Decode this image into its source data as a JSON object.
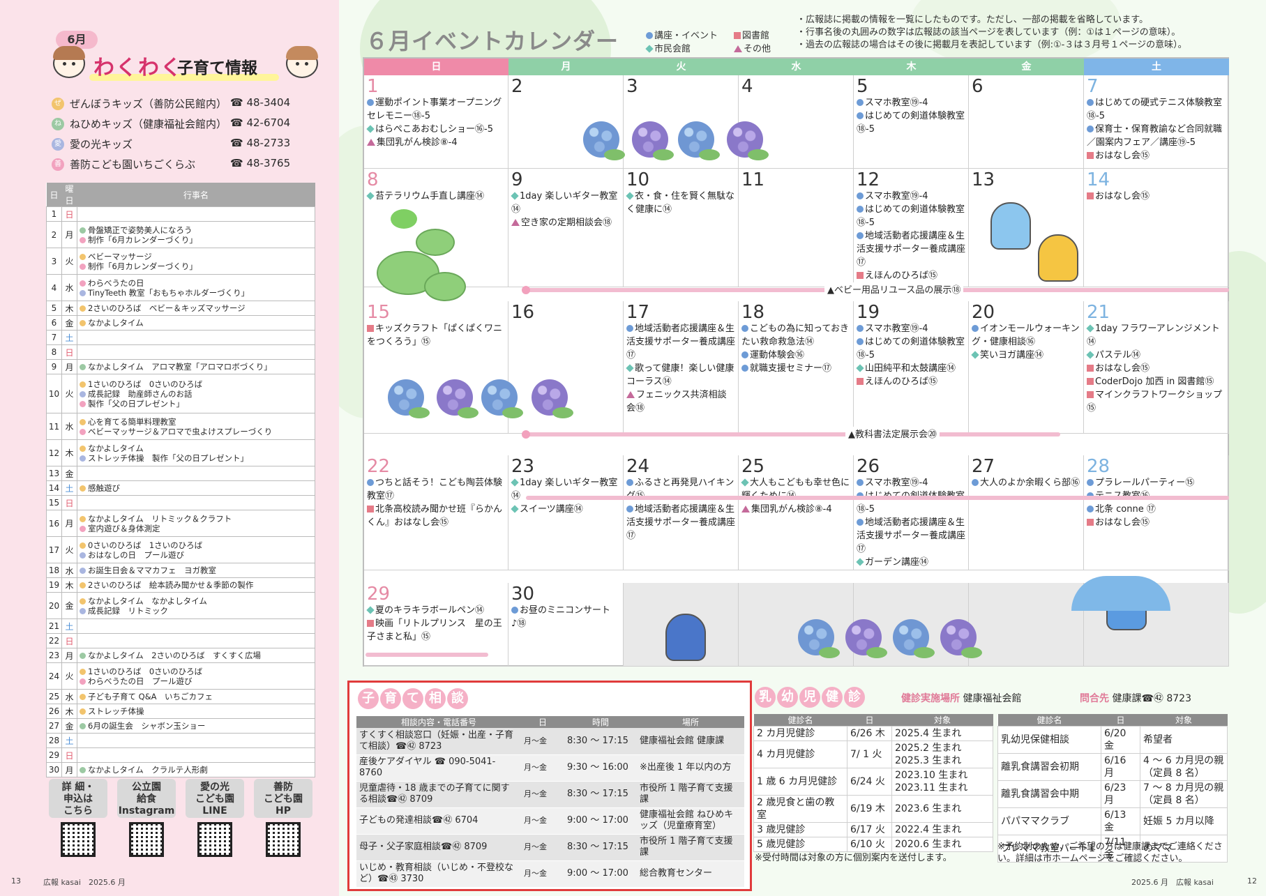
{
  "left": {
    "month": "6月",
    "title_main": "わくわく",
    "title_sub": "子育て情報",
    "facilities": [
      {
        "icon": "ぜ",
        "color": "#f2c46d",
        "name": "ぜんぼうキッズ（善防公民館内）",
        "tel": "☎ 48-3404"
      },
      {
        "icon": "ね",
        "color": "#9cc9a3",
        "name": "ねひめキッズ（健康福祉会館内）",
        "tel": "☎ 42-6704"
      },
      {
        "icon": "愛",
        "color": "#a9b6e0",
        "name": "愛の光キッズ",
        "tel": "☎ 48-2733"
      },
      {
        "icon": "善",
        "color": "#f2a2bf",
        "name": "善防こども園いちごくらぶ",
        "tel": "☎ 48-3765"
      }
    ],
    "headers": [
      "日",
      "曜日",
      "行事名"
    ],
    "rows": [
      {
        "d": "1",
        "w": "日",
        "c": "sun",
        "h": 1,
        "e": []
      },
      {
        "d": "2",
        "w": "月",
        "h": 2,
        "e": [
          [
            "k2",
            "骨盤矯正で姿勢美人になろう"
          ],
          [
            "k4",
            "制作「6月カレンダーづくり」"
          ]
        ]
      },
      {
        "d": "3",
        "w": "火",
        "h": 2,
        "e": [
          [
            "k1",
            "ベビーマッサージ"
          ],
          [
            "k4",
            "制作「6月カレンダーづくり」"
          ]
        ]
      },
      {
        "d": "4",
        "w": "水",
        "h": 2,
        "e": [
          [
            "k4",
            "わらべうたの日"
          ],
          [
            "k3",
            "TinyTeeth 教室「おもちゃホルダーづくり」"
          ]
        ]
      },
      {
        "d": "5",
        "w": "木",
        "h": 1,
        "e": [
          [
            "k1",
            "2さいのひろば　ベビー＆キッズマッサージ"
          ]
        ]
      },
      {
        "d": "6",
        "w": "金",
        "h": 1,
        "e": [
          [
            "k1",
            "なかよしタイム"
          ]
        ]
      },
      {
        "d": "7",
        "w": "土",
        "c": "sat",
        "h": 1,
        "e": []
      },
      {
        "d": "8",
        "w": "日",
        "c": "sun",
        "h": 1,
        "e": []
      },
      {
        "d": "9",
        "w": "月",
        "h": 1,
        "e": [
          [
            "k2",
            "なかよしタイム　アロマ教室「アロマロボづくり」"
          ]
        ]
      },
      {
        "d": "10",
        "w": "火",
        "h": 3,
        "e": [
          [
            "k1",
            "1さいのひろば　0さいのひろば"
          ],
          [
            "k3",
            "成長記録　助産師さんのお話"
          ],
          [
            "k4",
            "製作「父の日プレゼント」"
          ]
        ]
      },
      {
        "d": "11",
        "w": "水",
        "h": 2,
        "e": [
          [
            "k1",
            "心を育てる簡単料理教室"
          ],
          [
            "k4",
            "ベビーマッサージ＆アロマで虫よけスプレーづくり"
          ]
        ]
      },
      {
        "d": "12",
        "w": "木",
        "h": 2,
        "e": [
          [
            "k1",
            "なかよしタイム"
          ],
          [
            "k3",
            "ストレッチ体操　製作「父の日プレゼント」"
          ]
        ]
      },
      {
        "d": "13",
        "w": "金",
        "h": 1,
        "e": []
      },
      {
        "d": "14",
        "w": "土",
        "c": "sat",
        "h": 1,
        "e": [
          [
            "k1",
            "感触遊び"
          ]
        ]
      },
      {
        "d": "15",
        "w": "日",
        "c": "sun",
        "h": 1,
        "e": []
      },
      {
        "d": "16",
        "w": "月",
        "h": 2,
        "e": [
          [
            "k1",
            "なかよしタイム　リトミック＆クラフト"
          ],
          [
            "k4",
            "室内遊び＆身体測定"
          ]
        ]
      },
      {
        "d": "17",
        "w": "火",
        "h": 2,
        "e": [
          [
            "k1",
            "0さいのひろば　1さいのひろば"
          ],
          [
            "k3",
            "おはなしの日　プール遊び"
          ]
        ]
      },
      {
        "d": "18",
        "w": "水",
        "h": 1,
        "e": [
          [
            "k3",
            "お誕生日会＆ママカフェ　ヨガ教室"
          ]
        ]
      },
      {
        "d": "19",
        "w": "木",
        "h": 1,
        "e": [
          [
            "k1",
            "2さいのひろば　絵本読み聞かせ＆季節の製作"
          ]
        ]
      },
      {
        "d": "20",
        "w": "金",
        "h": 2,
        "e": [
          [
            "k1",
            "なかよしタイム　なかよしタイム"
          ],
          [
            "k3",
            "成長記録　リトミック"
          ]
        ]
      },
      {
        "d": "21",
        "w": "土",
        "c": "sat",
        "h": 1,
        "e": []
      },
      {
        "d": "22",
        "w": "日",
        "c": "sun",
        "h": 1,
        "e": []
      },
      {
        "d": "23",
        "w": "月",
        "h": 1,
        "e": [
          [
            "k2",
            "なかよしタイム　2さいのひろば　すくすく広場"
          ]
        ]
      },
      {
        "d": "24",
        "w": "火",
        "h": 2,
        "e": [
          [
            "k1",
            "1さいのひろば　0さいのひろば"
          ],
          [
            "k4",
            "わらべうたの日　プール遊び"
          ]
        ]
      },
      {
        "d": "25",
        "w": "水",
        "h": 1,
        "e": [
          [
            "k1",
            "子ども子育て Q&A　いちごカフェ"
          ]
        ]
      },
      {
        "d": "26",
        "w": "木",
        "h": 1,
        "e": [
          [
            "k1",
            "ストレッチ体操"
          ]
        ]
      },
      {
        "d": "27",
        "w": "金",
        "h": 1,
        "e": [
          [
            "k2",
            "6月の誕生会　シャボン玉ショー"
          ]
        ]
      },
      {
        "d": "28",
        "w": "土",
        "c": "sat",
        "h": 1,
        "e": []
      },
      {
        "d": "29",
        "w": "日",
        "c": "sun",
        "h": 1,
        "e": []
      },
      {
        "d": "30",
        "w": "月",
        "h": 1,
        "e": [
          [
            "k2",
            "なかよしタイム　クラルテ人形劇"
          ]
        ]
      }
    ],
    "qr": [
      {
        "label": "詳 細・\n申込は\nこちら"
      },
      {
        "label": "公立園\n給食\nInstagram"
      },
      {
        "label": "愛の光\nこども園\nLINE"
      },
      {
        "label": "善防\nこども園\nHP"
      }
    ],
    "page": "13",
    "footer": "広報 kasai　2025.6 月"
  },
  "calendar": {
    "title": "６月イベントカレンダー",
    "legend": {
      "event": "講座・イベント",
      "library": "図書館",
      "hall": "市民会館",
      "other": "その他"
    },
    "notes": [
      "・広報誌に掲載の情報を一覧にしたものです。ただし、一部の掲載を省略しています。",
      "・行事名後の丸囲みの数字は広報誌の該当ページを表しています（例：①は１ページの意味）。",
      "・過去の広報誌の場合はその後に掲載月を表記しています（例:①-３は３月号１ページの意味）。"
    ],
    "days": [
      "日",
      "月",
      "火",
      "水",
      "木",
      "金",
      "土"
    ],
    "weeks": [
      [
        {
          "n": "1",
          "ev": [
            [
              "b",
              "運動ポイント事業オープニングセレモニー⑱-5"
            ],
            [
              "g",
              "はらぺこあおむしショー⑯-5"
            ],
            [
              "p",
              "集団乳がん検診⑧-4"
            ]
          ]
        },
        {
          "n": "2",
          "ev": []
        },
        {
          "n": "3",
          "ev": []
        },
        {
          "n": "4",
          "ev": []
        },
        {
          "n": "5",
          "ev": [
            [
              "b",
              "スマホ教室⑲-4"
            ],
            [
              "b",
              "はじめての剣道体験教室⑱-5"
            ]
          ]
        },
        {
          "n": "6",
          "ev": []
        },
        {
          "n": "7",
          "ev": [
            [
              "b",
              "はじめての硬式テニス体験教室⑱-5"
            ],
            [
              "b",
              "保育士・保育教諭など合同就職／園案内フェア／講座⑲-5"
            ],
            [
              "r",
              "おはなし会⑮"
            ]
          ]
        }
      ],
      [
        {
          "n": "8",
          "ev": [
            [
              "g",
              "苔テラリウム手直し講座⑭"
            ]
          ]
        },
        {
          "n": "9",
          "ev": [
            [
              "g",
              "1day 楽しいギター教室⑭"
            ],
            [
              "p",
              "空き家の定期相談会⑱"
            ]
          ]
        },
        {
          "n": "10",
          "ev": [
            [
              "g",
              "衣・食・住を賢く無駄なく健康に⑭"
            ]
          ]
        },
        {
          "n": "11",
          "ev": []
        },
        {
          "n": "12",
          "ev": [
            [
              "b",
              "スマホ教室⑲-4"
            ],
            [
              "b",
              "はじめての剣道体験教室⑱-5"
            ],
            [
              "b",
              "地域活動者応援講座＆生活支援サポーター養成講座⑰"
            ],
            [
              "r",
              "えほんのひろば⑮"
            ]
          ]
        },
        {
          "n": "13",
          "ev": []
        },
        {
          "n": "14",
          "ev": [
            [
              "r",
              "おはなし会⑮"
            ]
          ]
        }
      ],
      [
        {
          "n": "15",
          "ev": [
            [
              "r",
              "キッズクラフト「ぱくぱくワニをつくろう」⑮"
            ]
          ]
        },
        {
          "n": "16",
          "ev": []
        },
        {
          "n": "17",
          "ev": [
            [
              "b",
              "地域活動者応援講座＆生活支援サポーター養成講座⑰"
            ],
            [
              "g",
              "歌って健康！楽しい健康コーラス⑭"
            ],
            [
              "p",
              "フェニックス共済相談会⑱"
            ]
          ]
        },
        {
          "n": "18",
          "ev": [
            [
              "b",
              "こどもの為に知っておきたい救命救急法⑭"
            ],
            [
              "b",
              "運動体験会⑯"
            ],
            [
              "b",
              "就職支援セミナー⑰"
            ]
          ]
        },
        {
          "n": "19",
          "ev": [
            [
              "b",
              "スマホ教室⑲-4"
            ],
            [
              "b",
              "はじめての剣道体験教室⑱-5"
            ],
            [
              "g",
              "山田純平和太鼓講座⑭"
            ],
            [
              "r",
              "えほんのひろば⑮"
            ]
          ]
        },
        {
          "n": "20",
          "ev": [
            [
              "b",
              "イオンモールウォーキング・健康相談⑯"
            ],
            [
              "g",
              "笑いヨガ講座⑭"
            ]
          ]
        },
        {
          "n": "21",
          "ev": [
            [
              "g",
              "1day フラワーアレンジメント⑭"
            ],
            [
              "g",
              "パステル⑭"
            ],
            [
              "r",
              "おはなし会⑮"
            ],
            [
              "r",
              "CoderDojo 加西 in 図書館⑮"
            ],
            [
              "r",
              "マインクラフトワークショップ⑮"
            ]
          ]
        }
      ],
      [
        {
          "n": "22",
          "ev": [
            [
              "b",
              "つちと話そう！こども陶芸体験教室⑰"
            ],
            [
              "r",
              "北条高校読み聞かせ班『らかんくん』おはなし会⑮"
            ]
          ]
        },
        {
          "n": "23",
          "ev": [
            [
              "g",
              "1day 楽しいギター教室⑭"
            ],
            [
              "g",
              "スイーツ講座⑭"
            ]
          ]
        },
        {
          "n": "24",
          "ev": [
            [
              "b",
              "ふるさと再発見ハイキング⑮"
            ],
            [
              "b",
              "地域活動者応援講座＆生活支援サポーター養成講座⑰"
            ]
          ]
        },
        {
          "n": "25",
          "ev": [
            [
              "g",
              "大人もこどもも幸せ色に輝くために⑭"
            ],
            [
              "p",
              "集団乳がん検診⑧-4"
            ]
          ]
        },
        {
          "n": "26",
          "ev": [
            [
              "b",
              "スマホ教室⑲-4"
            ],
            [
              "b",
              "はじめての剣道体験教室⑱-5"
            ],
            [
              "b",
              "地域活動者応援講座＆生活支援サポーター養成講座⑰"
            ],
            [
              "g",
              "ガーデン講座⑭"
            ]
          ]
        },
        {
          "n": "27",
          "ev": [
            [
              "b",
              "大人のよか余暇くら部⑯"
            ]
          ]
        },
        {
          "n": "28",
          "ev": [
            [
              "b",
              "プラレールパーティー⑮"
            ],
            [
              "b",
              "テニス教室⑯"
            ],
            [
              "b",
              "北条 conne ⑰"
            ],
            [
              "r",
              "おはなし会⑮"
            ]
          ]
        }
      ],
      [
        {
          "n": "29",
          "ev": [
            [
              "g",
              "夏のキラキラボールペン⑭"
            ],
            [
              "r",
              "映画「リトルプリンス　星の王子さまと私」⑮"
            ]
          ]
        },
        {
          "n": "30",
          "ev": [
            [
              "b",
              "お昼のミニコンサート♪⑱"
            ]
          ]
        },
        {
          "n": "",
          "ev": []
        },
        {
          "n": "",
          "ev": []
        },
        {
          "n": "",
          "ev": []
        },
        {
          "n": "",
          "ev": []
        },
        {
          "n": "",
          "ev": []
        }
      ]
    ],
    "bands": [
      {
        "label": "▲ベビー用品リユース品の展示⑱"
      },
      {
        "label": "▲教科書法定展示会⑳"
      }
    ]
  },
  "consult": {
    "title": [
      "子",
      "育",
      "て",
      "相",
      "談"
    ],
    "headers": [
      "相談内容・電話番号",
      "日",
      "時間",
      "場所"
    ],
    "rows": [
      [
        "すくすく相談窓口（妊娠・出産・子育て相談）☎㊷ 8723",
        "月〜金",
        "8:30 〜 17:15",
        "健康福祉会館 健康課"
      ],
      [
        "産後ケアダイヤル ☎ 090-5041-8760",
        "月〜金",
        "9:30 〜 16:00",
        "※出産後 1 年以内の方"
      ],
      [
        "児童虐待・18 歳までの子育てに関する相談☎㊷ 8709",
        "月〜金",
        "8:30 〜 17:15",
        "市役所 1 階子育て支援課"
      ],
      [
        "子どもの発達相談☎㊷ 6704",
        "月〜金",
        "9:00 〜 17:00",
        "健康福祉会館 ねひめキッズ（児童療育室）"
      ],
      [
        "母子・父子家庭相談☎㊷ 8709",
        "月〜金",
        "8:30 〜 17:15",
        "市役所 1 階子育て支援課"
      ],
      [
        "いじめ・教育相談（いじめ・不登校など）☎㊸ 3730",
        "月〜金",
        "9:00 〜 17:00",
        "総合教育センター"
      ]
    ]
  },
  "health": {
    "title": [
      "乳",
      "幼",
      "児",
      "健",
      "診"
    ],
    "place_label": "健診実施場所",
    "place": "健康福祉会館",
    "contact_label": "問合先",
    "contact": "健康課☎㊷ 8723",
    "headers": [
      "健診名",
      "日",
      "対象"
    ],
    "rows": [
      [
        "2 カ月児健診",
        "6/26 木",
        "2025.4 生まれ"
      ],
      [
        "4 カ月児健診",
        "7/ 1 火",
        "2025.2 生まれ\n2025.3 生まれ"
      ],
      [
        "1 歳 6 カ月児健診",
        "6/24 火",
        "2023.10 生まれ\n2023.11 生まれ"
      ],
      [
        "2 歳児食と歯の教室",
        "6/19 木",
        "2023.6 生まれ"
      ],
      [
        "3 歳児健診",
        "6/17 火",
        "2022.4 生まれ"
      ],
      [
        "5 歳児健診",
        "6/10 火",
        "2020.6 生まれ"
      ]
    ],
    "note1": "※受付時間は対象の方に個別案内を送付します。",
    "rows2": [
      [
        "乳幼児保健相談",
        "6/20 金",
        "希望者"
      ],
      [
        "離乳食講習会初期",
        "6/16 月",
        "4 〜 6 カ月児の親（定員 8 名）"
      ],
      [
        "離乳食講習会中期",
        "6/23 月",
        "7 〜 8 カ月児の親（定員 8 名）"
      ],
      [
        "パパママクラブ",
        "6/13 金",
        "妊娠 5 カ月以降"
      ],
      [
        "プレママ教室パート1",
        "7/11 金",
        "のママ"
      ]
    ],
    "note2": "※予約制のため、ご希望の方は健康課までご連絡ください。詳細は市ホームページをご確認ください。",
    "footer": "2025.6 月　広報 kasai",
    "page": "12"
  }
}
